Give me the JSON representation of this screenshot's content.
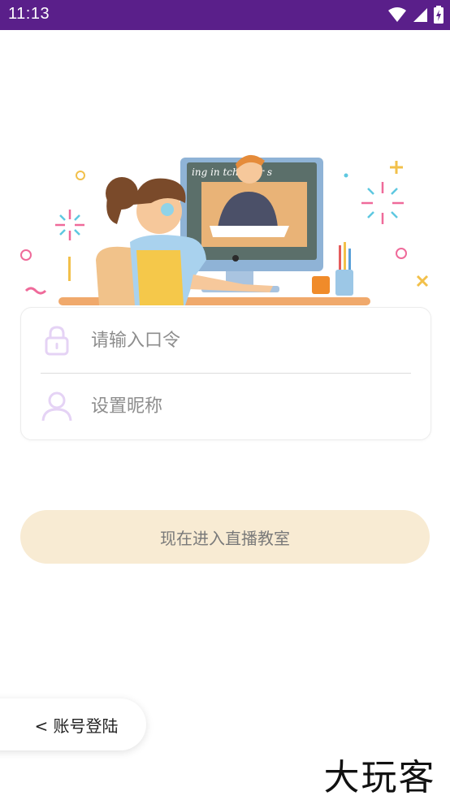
{
  "status_bar": {
    "time": "11:13",
    "bg_color": "#5a1f8a",
    "icons": [
      "wifi-icon",
      "signal-icon",
      "battery-charging-icon"
    ]
  },
  "form": {
    "password_placeholder": "请输入口令",
    "password_value": "",
    "nickname_placeholder": "设置昵称",
    "nickname_value": "",
    "icons": [
      "lock-icon",
      "user-icon"
    ],
    "icon_color": "#e5d3f5"
  },
  "enter_button": {
    "label": "现在进入直播教室",
    "bg_color": "#f8ebd3"
  },
  "account_login": {
    "label": "< 账号登陆"
  },
  "brand": {
    "logo_text": "大玩客"
  },
  "illustration": {
    "board_text": "ing in  tch your s"
  }
}
